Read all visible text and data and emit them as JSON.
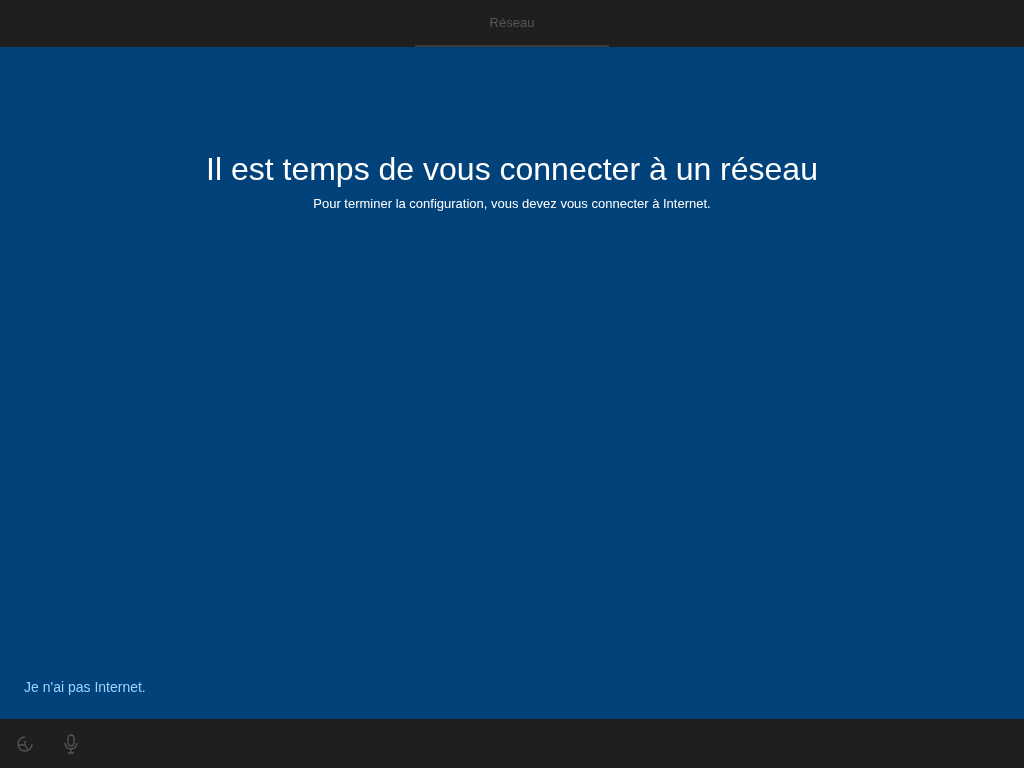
{
  "tabs": [
    {
      "label": "Réseau",
      "selected": true
    }
  ],
  "heading": "Il est temps de vous connecter à un réseau",
  "subtitle": "Pour terminer la configuration, vous devez vous connecter à Internet.",
  "skip_link": "Je n'ai pas Internet."
}
